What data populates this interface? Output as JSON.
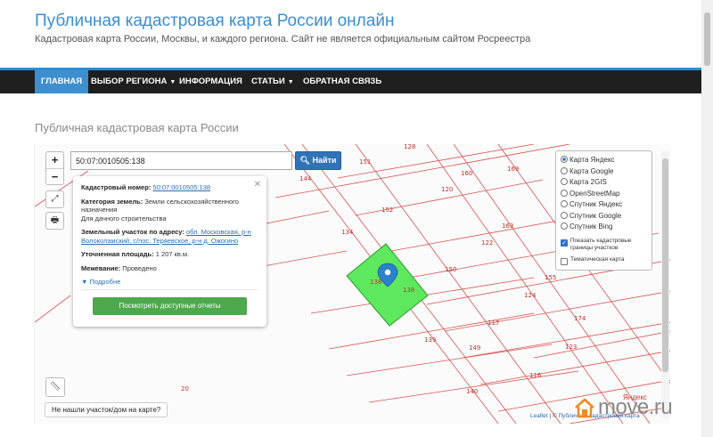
{
  "header": {
    "title": "Публичная кадастровая карта России онлайн",
    "subtitle": "Кадастровая карта России, Москвы, и каждого региона. Сайт не является официальным сайтом Росреестра"
  },
  "nav": {
    "items": [
      {
        "label": "ГЛАВНАЯ",
        "active": true
      },
      {
        "label": "ВЫБОР РЕГИОНА",
        "dropdown": true
      },
      {
        "label": "ИНФОРМАЦИЯ"
      },
      {
        "label": "СТАТЬИ",
        "dropdown": true
      },
      {
        "label": "ОБРАТНАЯ СВЯЗЬ"
      }
    ],
    "accent_color": "#3d8fcf",
    "bar_color": "#1f1f1f"
  },
  "page": {
    "title": "Публичная кадастровая карта России"
  },
  "map": {
    "search": {
      "value": "50:07:0010505:138",
      "button_label": "Найти",
      "button_icon": "search-icon"
    },
    "zoom": {
      "in": "+",
      "out": "−"
    },
    "popup": {
      "cadastral_label": "Кадастровый номер:",
      "cadastral_value": "50:07:0010505:138",
      "category_label": "Категория земель:",
      "category_value": "Земли сельскохозяйственного назначения",
      "usage_value": "Для дачного строительства",
      "address_label": "Земельный участок по адресу:",
      "address_value": "обл. Московская, р-н Волоколамский, с/пос. Теряевское, р-н д. Ожогино",
      "area_label": "Уточненная площадь:",
      "area_value": "1 207 кв.м.",
      "boundary_label": "Межевание:",
      "boundary_value": "Проведено",
      "more_label": "Подробне",
      "reports_button": "Посмотреть доступные отчеты",
      "reports_color": "#4ea84e"
    },
    "layers": {
      "options": [
        {
          "label": "Карта Яндекс",
          "selected": true
        },
        {
          "label": "Карта Google",
          "selected": false
        },
        {
          "label": "Карта 2GIS",
          "selected": false
        },
        {
          "label": "OpenStreetMap",
          "selected": false
        },
        {
          "label": "Спутник Яндекс",
          "selected": false
        },
        {
          "label": "Спутник Google",
          "selected": false
        },
        {
          "label": "Спутник Bing",
          "selected": false
        }
      ],
      "checkboxes": [
        {
          "label": "Показать кадастровые границы участков",
          "checked": true
        },
        {
          "label": "Тематическая карта",
          "checked": false
        }
      ]
    },
    "parcel_numbers": [
      "128",
      "151",
      "169",
      "144",
      "160",
      "120",
      "152",
      "134",
      "163",
      "122",
      "150",
      "155",
      "124",
      "138",
      "59",
      "117",
      "174",
      "139",
      "123",
      "149",
      "116",
      "140",
      "20"
    ],
    "selected_parcel_labels": [
      "138",
      "138"
    ],
    "not_found_button": "Не нашли участок/дом на карте?",
    "attribution": {
      "leaflet": "Leaflet",
      "sep": " | © ",
      "source": "Публичная кадастровая карта"
    },
    "yandex_mark": "Яндекс",
    "selected_color": "#5ee85e"
  },
  "watermark": {
    "text": "move.ru",
    "house_color": "#f08a24"
  }
}
